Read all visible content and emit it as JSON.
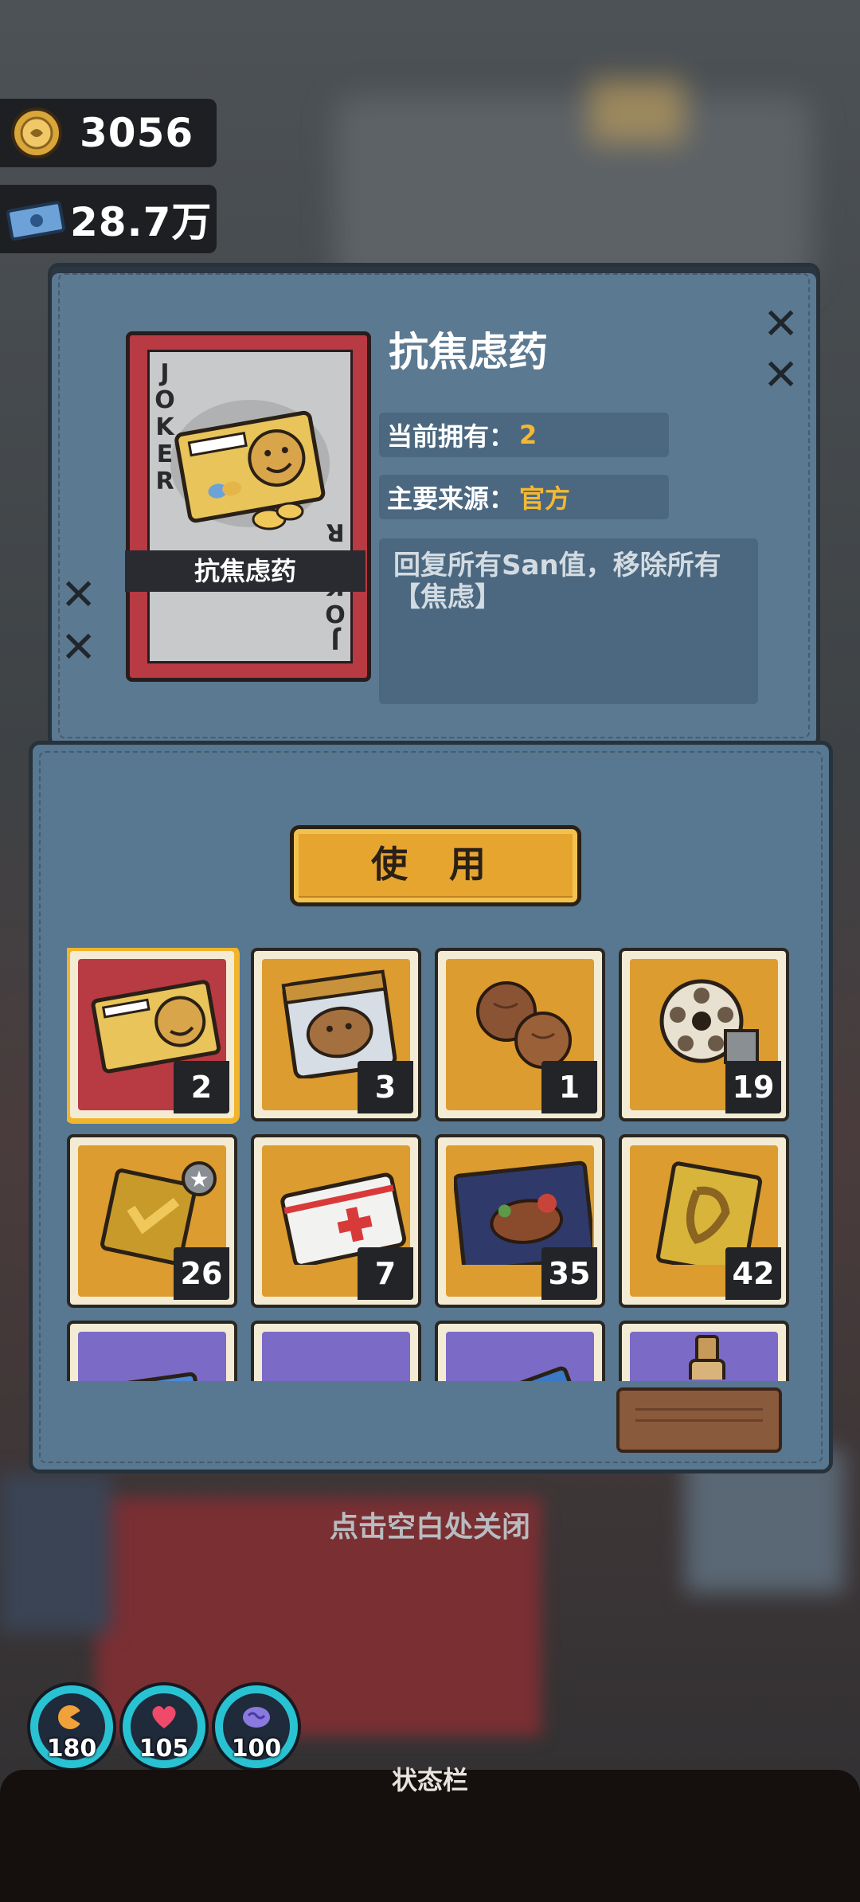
{
  "currency": {
    "coins": "3056",
    "cash": "28.7万"
  },
  "item": {
    "name": "抗焦虑药",
    "card_label": "抗焦虑药",
    "card_corner": "JOKER",
    "owned_label": "当前拥有：",
    "owned_value": "2",
    "source_label": "主要来源：",
    "source_value": "官方",
    "description": "回复所有San值，移除所有【焦虑】"
  },
  "use_button": "使 用",
  "inventory": [
    {
      "icon": "id-card-pill-icon",
      "count": "2",
      "bg": "#b83a43",
      "selected": true
    },
    {
      "icon": "capybara-snack-bag-icon",
      "count": "3",
      "bg": "#dc9c2f"
    },
    {
      "icon": "walnut-icon",
      "count": "1",
      "bg": "#dc9c2f"
    },
    {
      "icon": "film-reel-icon",
      "count": "19",
      "bg": "#dc9c2f"
    },
    {
      "icon": "badge-plaque-icon",
      "count": "26",
      "bg": "#dc9c2f"
    },
    {
      "icon": "medical-card-icon",
      "count": "7",
      "bg": "#dc9c2f"
    },
    {
      "icon": "steak-meal-icon",
      "count": "35",
      "bg": "#dc9c2f"
    },
    {
      "icon": "gold-ribbon-card-icon",
      "count": "42",
      "bg": "#dc9c2f"
    },
    {
      "icon": "blue-ticket-icon",
      "count": "",
      "bg": "#7b6ac6"
    },
    {
      "icon": "blue-item-icon",
      "count": "",
      "bg": "#7b6ac6"
    },
    {
      "icon": "blue-card-icon",
      "count": "",
      "bg": "#7b6ac6"
    },
    {
      "icon": "bottle-icon",
      "count": "",
      "bg": "#7b6ac6"
    }
  ],
  "hint": "点击空白处关闭",
  "status_bar": {
    "label": "状态栏",
    "hunger": "180",
    "health": "105",
    "sanity": "100"
  },
  "colors": {
    "accent": "#f5b833",
    "panel": "#587790",
    "rare_bg": "#b83a43",
    "common_bg": "#dc9c2f",
    "epic_bg": "#7b6ac6",
    "stat_ring": "#29c2d3"
  }
}
